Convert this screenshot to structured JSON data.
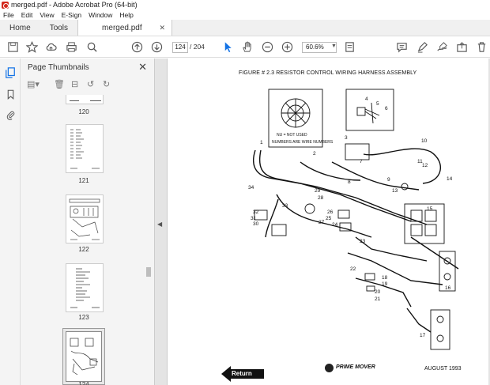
{
  "window": {
    "title": "merged.pdf - Adobe Acrobat Pro (64-bit)"
  },
  "menu": [
    "File",
    "Edit",
    "View",
    "E-Sign",
    "Window",
    "Help"
  ],
  "tabs": {
    "home": "Home",
    "tools": "Tools",
    "document": "merged.pdf"
  },
  "toolbar": {
    "current_page": "124",
    "page_total": "/ 204",
    "zoom": "60.6%"
  },
  "thumbnails_panel": {
    "title": "Page Thumbnails",
    "pages": [
      "120",
      "121",
      "122",
      "123",
      "124"
    ]
  },
  "document": {
    "figure_title": "FIGURE # 2.3   RESISTOR CONTROL WIRING HARNESS ASSEMBLY",
    "inset_note_1": "NU = NOT USED",
    "inset_note_2": "NUMBERS ARE WIRE NUMBERS",
    "callouts": [
      "1",
      "2",
      "3",
      "4",
      "5",
      "6",
      "7",
      "8",
      "9",
      "10",
      "11",
      "12",
      "13",
      "14",
      "15",
      "16",
      "17",
      "18",
      "19",
      "20",
      "21",
      "22",
      "23",
      "24",
      "25",
      "26",
      "27",
      "28",
      "29",
      "30",
      "31",
      "32",
      "33",
      "34"
    ],
    "brand": "PRIME MOVER",
    "date": "AUGUST 1993",
    "return_label": "Return"
  }
}
